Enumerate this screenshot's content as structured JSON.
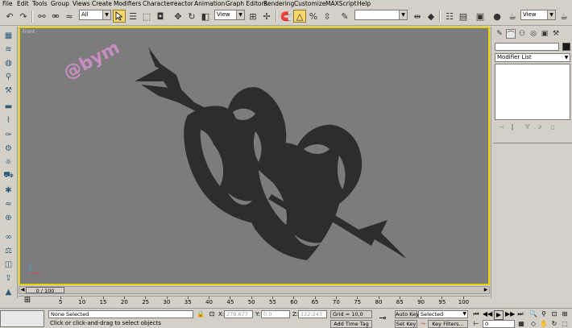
{
  "menu": [
    "File",
    "Edit",
    "Tools",
    "Group",
    "Views",
    "Create",
    "Modifiers",
    "Character",
    "reactor",
    "Animation",
    "Graph Editors",
    "Rendering",
    "Customize",
    "MAXScript",
    "Help"
  ],
  "toolbar": {
    "selection_filter": "All",
    "reference_coord": "View",
    "named_selection": "",
    "render_viewport": "View"
  },
  "viewport": {
    "label": "Front",
    "watermark": "@bym",
    "accent_color": "#e3d200",
    "background_color": "#7c7c7c"
  },
  "command_panel": {
    "object_name": "",
    "modifier_list": "Modifier List"
  },
  "time": {
    "frame_display": "0 / 100",
    "ticks": [
      "5",
      "10",
      "15",
      "20",
      "25",
      "30",
      "35",
      "40",
      "45",
      "50",
      "55",
      "60",
      "65",
      "70",
      "75",
      "80",
      "85",
      "90",
      "95",
      "100"
    ]
  },
  "status": {
    "selection": "None Selected",
    "prompt": "Click or click-and-drag to select objects",
    "x_label": "X:",
    "x_value": "279.677",
    "y_label": "Y:",
    "y_value": "0.0",
    "z_label": "Z:",
    "z_value": "122.243",
    "grid": "Grid = 10,0",
    "add_time_tag": "Add Time Tag",
    "auto_key": "Auto Key",
    "set_key": "Set Key",
    "key_mode": "Selected",
    "key_filters": "Key Filters...",
    "current_frame": "0"
  }
}
